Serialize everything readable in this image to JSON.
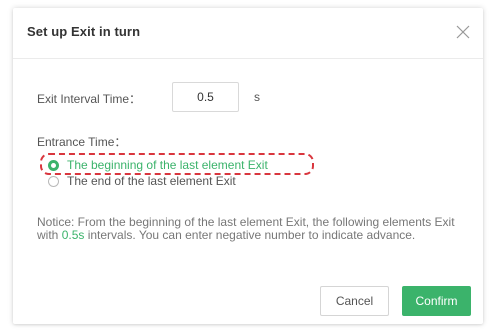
{
  "dialog": {
    "title": "Set up Exit in turn",
    "close_icon": "close-icon"
  },
  "interval": {
    "label": "Exit Interval Time：",
    "value": "0.5",
    "unit": "s"
  },
  "entrance": {
    "label": "Entrance Time：",
    "options": [
      {
        "label": "The beginning of the last element Exit",
        "selected": true
      },
      {
        "label": "The end of the last element Exit",
        "selected": false
      }
    ]
  },
  "notice": {
    "prefix": "Notice: From the beginning of the last element Exit, the following elements Exit with ",
    "highlight": "0.5s",
    "suffix": " intervals. You can enter negative number to indicate advance."
  },
  "buttons": {
    "cancel": "Cancel",
    "confirm": "Confirm"
  },
  "colors": {
    "accent": "#3bb36b",
    "annotation": "#d9363e"
  }
}
